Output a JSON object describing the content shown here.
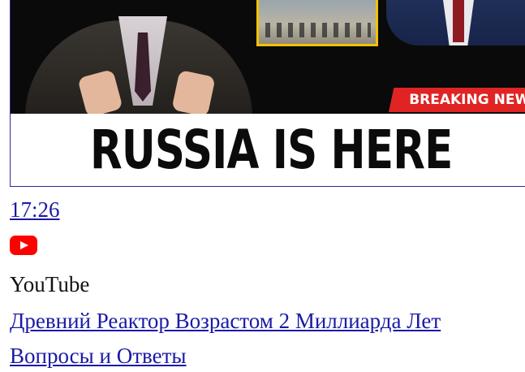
{
  "thumbnail": {
    "breaking_label": "BREAKING NEWS",
    "headline": "RUSSIA IS HERE"
  },
  "video": {
    "duration": "17:26",
    "source_icon": "youtube-icon",
    "source": "YouTube",
    "title": "Древний Реактор Возрастом 2 Миллиарда Лет",
    "channel": "Вопросы и Ответы"
  },
  "colors": {
    "link": "#1a1aa6",
    "youtube_red": "#ff0000",
    "breaking_red": "#e02424",
    "inset_border": "#f2c200"
  }
}
